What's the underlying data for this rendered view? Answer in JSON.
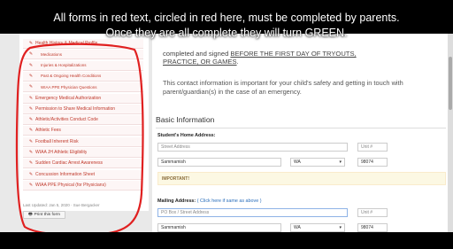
{
  "caption": {
    "line1": "All forms in red text, circled in red here, must be completed by parents.",
    "line2": "Once they are all complete they will turn GREEN."
  },
  "sidebar": {
    "items": [
      {
        "label": "Health History & Medical Profile",
        "sub": false
      },
      {
        "label": "Medications",
        "sub": true
      },
      {
        "label": "Injuries & Hospitalizations",
        "sub": true
      },
      {
        "label": "Past & Ongoing Health Conditions",
        "sub": true
      },
      {
        "label": "WIAA PPE Physician Questions",
        "sub": true
      },
      {
        "label": "Emergency Medical Authorization",
        "sub": false
      },
      {
        "label": "Permission to Share Medical Information",
        "sub": false
      },
      {
        "label": "Athletic/Activities Conduct Code",
        "sub": false
      },
      {
        "label": "Athletic Fees",
        "sub": false
      },
      {
        "label": "Football Inherent Risk",
        "sub": false
      },
      {
        "label": "WIAA JH Athletic Eligibility",
        "sub": false
      },
      {
        "label": "Sudden Cardiac Arrest Awareness",
        "sub": false
      },
      {
        "label": "Concussion Information Sheet",
        "sub": false
      },
      {
        "label": "WIAA PPE Physical (for Physicians)",
        "sub": false
      }
    ],
    "updated": "Last Updated: Jan 5, 2020 · Sue Bergacker",
    "print_label": "Print this form"
  },
  "main": {
    "intro_a": "completed and signed ",
    "intro_b": "BEFORE THE FIRST DAY OF TRYOUTS,",
    "intro_c": "PRACTICE, OR GAMES",
    "intro_d": ".",
    "intro2": "This contact information is important for your child's safety and getting in touch with parent/guardian(s) in the case of an emergency.",
    "section_title": "Basic Information",
    "home_label": "Student's Home Address:",
    "street_placeholder": "Street Address",
    "unit_placeholder": "Unit #",
    "city_value": "Sammamish",
    "state_value": "WA",
    "zip_value": "98074",
    "important": "IMPORTANT!",
    "mailing_label": "Mailing Address:",
    "mailing_link": "( Click here if same as above )",
    "po_placeholder": "PO Box / Street Address",
    "unit2_placeholder": "Unit #",
    "city2_value": "Sammamish",
    "state2_value": "WA",
    "zip2_value": "98074"
  }
}
